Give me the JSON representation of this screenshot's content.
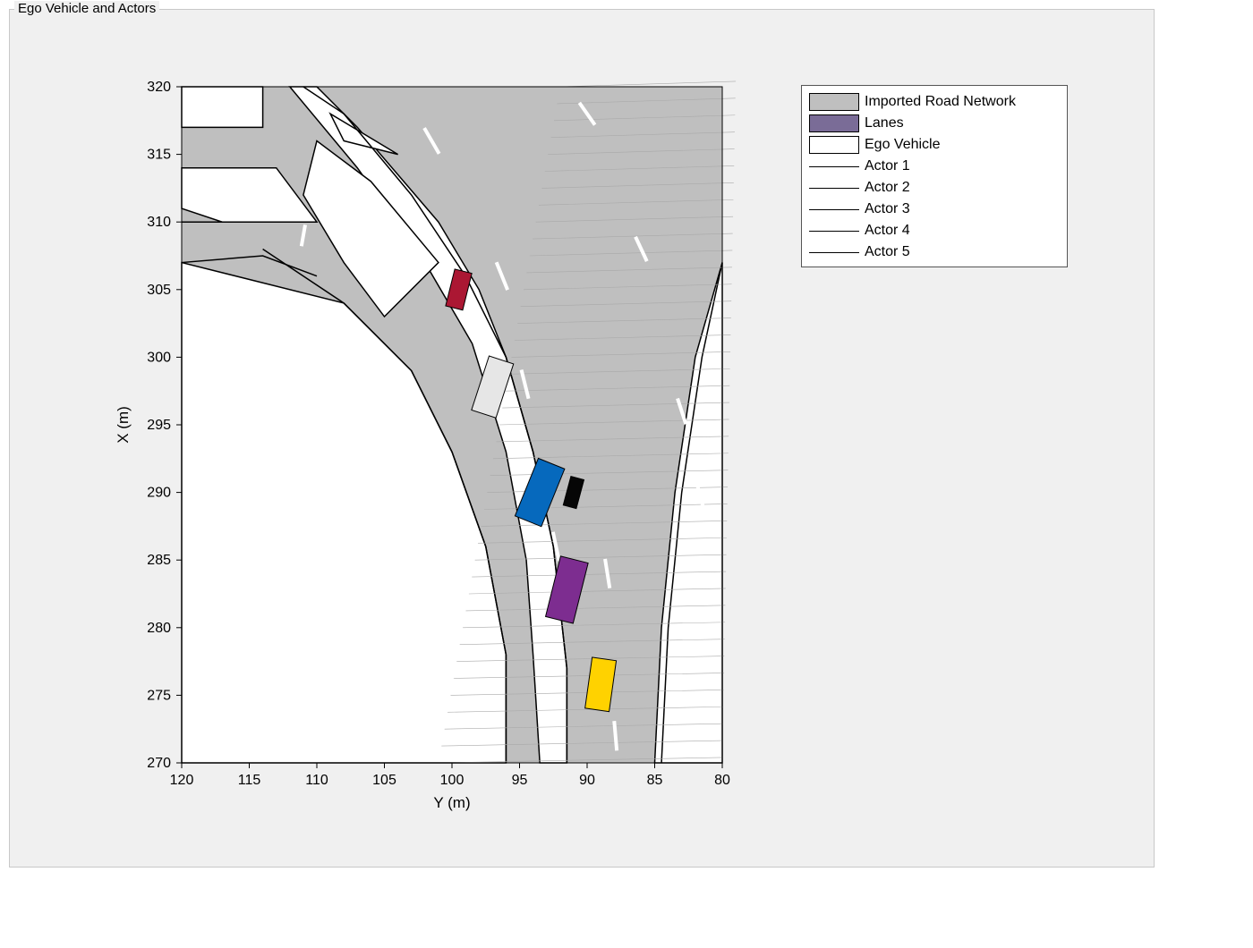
{
  "panel": {
    "title": "Ego Vehicle and Actors"
  },
  "axes": {
    "xlabel": "Y (m)",
    "ylabel": "X (m)",
    "x_ticks": [
      120,
      115,
      110,
      105,
      100,
      95,
      90,
      85,
      80
    ],
    "y_ticks": [
      270,
      275,
      280,
      285,
      290,
      295,
      300,
      305,
      310,
      315,
      320
    ]
  },
  "legend": {
    "items": [
      {
        "type": "swatch",
        "label": "Imported Road Network",
        "fill": "#bfbfbf",
        "stroke": "#000"
      },
      {
        "type": "swatch",
        "label": "Lanes",
        "fill": "#7a6c97",
        "stroke": "#000"
      },
      {
        "type": "swatch",
        "label": "Ego Vehicle",
        "fill": "#ffffff",
        "stroke": "#000"
      },
      {
        "type": "line",
        "label": "Actor 1"
      },
      {
        "type": "line",
        "label": "Actor 2"
      },
      {
        "type": "line",
        "label": "Actor 3"
      },
      {
        "type": "line",
        "label": "Actor 4"
      },
      {
        "type": "line",
        "label": "Actor 5"
      }
    ]
  },
  "chart_data": {
    "type": "scatter",
    "title": "Ego Vehicle and Actors",
    "xlabel": "Y (m)",
    "ylabel": "X (m)",
    "xlim": [
      120,
      80
    ],
    "ylim": [
      270,
      320
    ],
    "x_reversed": true,
    "road_network": "imported",
    "vehicles": [
      {
        "name": "Actor (red)",
        "x": 305.0,
        "y": 99.5,
        "heading_deg": -14,
        "w": 1.3,
        "l": 2.8,
        "color": "#ab1733"
      },
      {
        "name": "Actor (white)",
        "x": 297.8,
        "y": 97.0,
        "heading_deg": -18,
        "w": 1.9,
        "l": 4.2,
        "color": "#e6e6e6"
      },
      {
        "name": "Ego (blue)",
        "x": 290.0,
        "y": 93.5,
        "heading_deg": -22,
        "w": 2.1,
        "l": 4.6,
        "color": "#0669bd"
      },
      {
        "name": "Actor (black)",
        "x": 290.0,
        "y": 91.0,
        "heading_deg": -15,
        "w": 1.0,
        "l": 2.2,
        "color": "#060606"
      },
      {
        "name": "Actor (purple)",
        "x": 282.8,
        "y": 91.5,
        "heading_deg": -14,
        "w": 2.1,
        "l": 4.6,
        "color": "#7d2d90"
      },
      {
        "name": "Actor (yellow)",
        "x": 275.8,
        "y": 89.0,
        "heading_deg": -8,
        "w": 1.8,
        "l": 3.8,
        "color": "#ffd200"
      }
    ],
    "lane_markings": [
      {
        "x": 316,
        "y": 101.5,
        "heading": -30,
        "len": 2.2
      },
      {
        "x": 306,
        "y": 96.3,
        "heading": -22,
        "len": 2.2
      },
      {
        "x": 298,
        "y": 94.6,
        "heading": -14,
        "len": 2.2
      },
      {
        "x": 286,
        "y": 92.3,
        "heading": -12,
        "len": 2.2
      },
      {
        "x": 284,
        "y": 88.5,
        "heading": -9,
        "len": 2.2
      },
      {
        "x": 272,
        "y": 87.9,
        "heading": -5,
        "len": 2.2
      },
      {
        "x": 309,
        "y": 111.0,
        "heading": 10,
        "len": 1.6
      },
      {
        "x": 318,
        "y": 90.0,
        "heading": -35,
        "len": 2.0
      },
      {
        "x": 308,
        "y": 86.0,
        "heading": -25,
        "len": 2.0
      },
      {
        "x": 296,
        "y": 83.0,
        "heading": -18,
        "len": 2.0
      },
      {
        "x": 290,
        "y": 81.7,
        "heading": -15,
        "len": 2.0
      }
    ]
  }
}
